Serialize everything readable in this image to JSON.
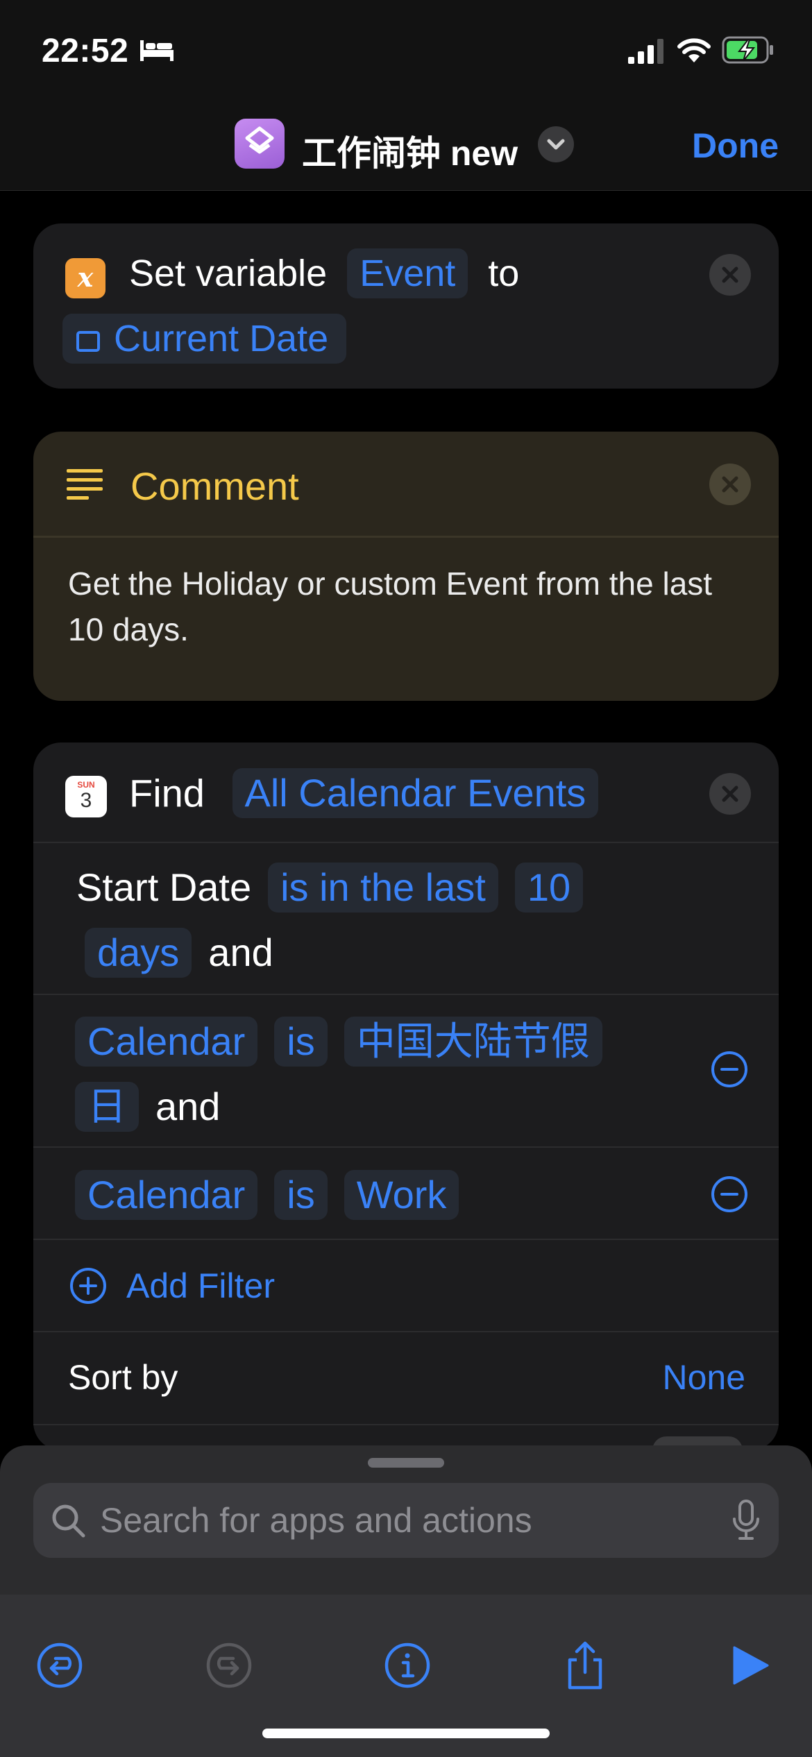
{
  "status_bar": {
    "time": "22:52",
    "icons": [
      "bed-icon",
      "signal-icon",
      "wifi-icon",
      "battery-charging-icon"
    ],
    "battery_color": "#4cd964"
  },
  "nav": {
    "title": "工作闹钟 new",
    "done_label": "Done",
    "accent_color": "#3a82f7"
  },
  "actions": {
    "set_variable": {
      "prefix": "Set variable",
      "variable": "Event",
      "to_word": "to",
      "value": "Current Date"
    },
    "comment": {
      "title": "Comment",
      "body": "Get the Holiday or custom Event from the last 10 days."
    },
    "find": {
      "verb": "Find",
      "target": "All Calendar Events",
      "calendar_icon_month": "SUN",
      "calendar_icon_day": "3",
      "filters": [
        {
          "field": "Start Date",
          "op": "is in the last",
          "value": "10",
          "unit": "days",
          "joiner": "and"
        },
        {
          "field": "Calendar",
          "op": "is",
          "value_line1": "中国大陆节假",
          "value_line2": "日",
          "joiner": "and"
        },
        {
          "field": "Calendar",
          "op": "is",
          "value": "Work"
        }
      ],
      "add_filter_label": "Add Filter",
      "sort_label": "Sort by",
      "sort_value": "None"
    }
  },
  "search": {
    "placeholder": "Search for apps and actions"
  },
  "toolbar": {
    "buttons": [
      "undo-icon",
      "redo-icon",
      "info-icon",
      "share-icon",
      "play-icon"
    ]
  }
}
